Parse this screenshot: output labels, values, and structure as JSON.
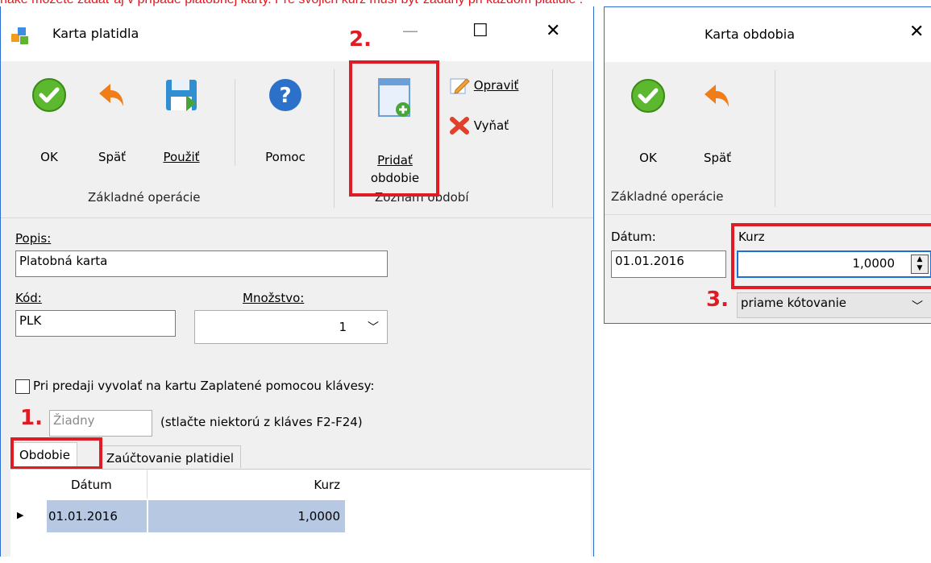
{
  "top_note": "ňaké môžete zadať aj v prípade platobnej karty. Pre svojich kurz musí byť zadaný pri každom platidle .",
  "window_main": {
    "title": "Karta platidla",
    "controls": {
      "minimize": "—",
      "maximize": "☐",
      "close": "✕"
    },
    "ribbon": {
      "groups": [
        {
          "label": "Základné operácie"
        },
        {
          "label": "Zoznam období"
        }
      ],
      "buttons": {
        "ok": "OK",
        "back": "Späť",
        "use": "Použiť",
        "help": "Pomoc",
        "add_period_line1": "Pridať",
        "add_period_line2": "obdobie",
        "edit": "Opraviť",
        "remove": "Vyňať"
      }
    },
    "form": {
      "popis_label": "Popis:",
      "popis_value": "Platobná karta",
      "kod_label": "Kód:",
      "kod_value": "PLK",
      "mnozstvo_label": "Množstvo:",
      "mnozstvo_value": "1",
      "checkbox_label": "Pri predaji vyvolať na kartu Zaplatené pomocou klávesy:",
      "hotkey_placeholder": "Žiadny",
      "hotkey_hint": "(stlačte niektorú z kláves F2-F24)",
      "tabs": [
        "Obdobie",
        "Zaúčtovanie platidiel"
      ],
      "grid": {
        "columns": [
          "Dátum",
          "Kurz"
        ],
        "rows": [
          {
            "datum": "01.01.2016",
            "kurz": "1,0000"
          }
        ]
      }
    }
  },
  "window_period": {
    "title": "Karta obdobia",
    "close": "✕",
    "ribbon": {
      "ok": "OK",
      "back": "Späť",
      "group_label": "Základné operácie"
    },
    "form": {
      "datum_label": "Dátum:",
      "datum_value": "01.01.2016",
      "kurz_label": "Kurz",
      "kurz_value": "1,0000",
      "quote_value": "priame kótovanie"
    }
  },
  "annotations": {
    "one": "1.",
    "two": "2.",
    "three": "3."
  },
  "colors": {
    "accent_blue": "#2a6fd1",
    "annotation_red": "#e01b24",
    "selection": "#b7c8e3"
  }
}
